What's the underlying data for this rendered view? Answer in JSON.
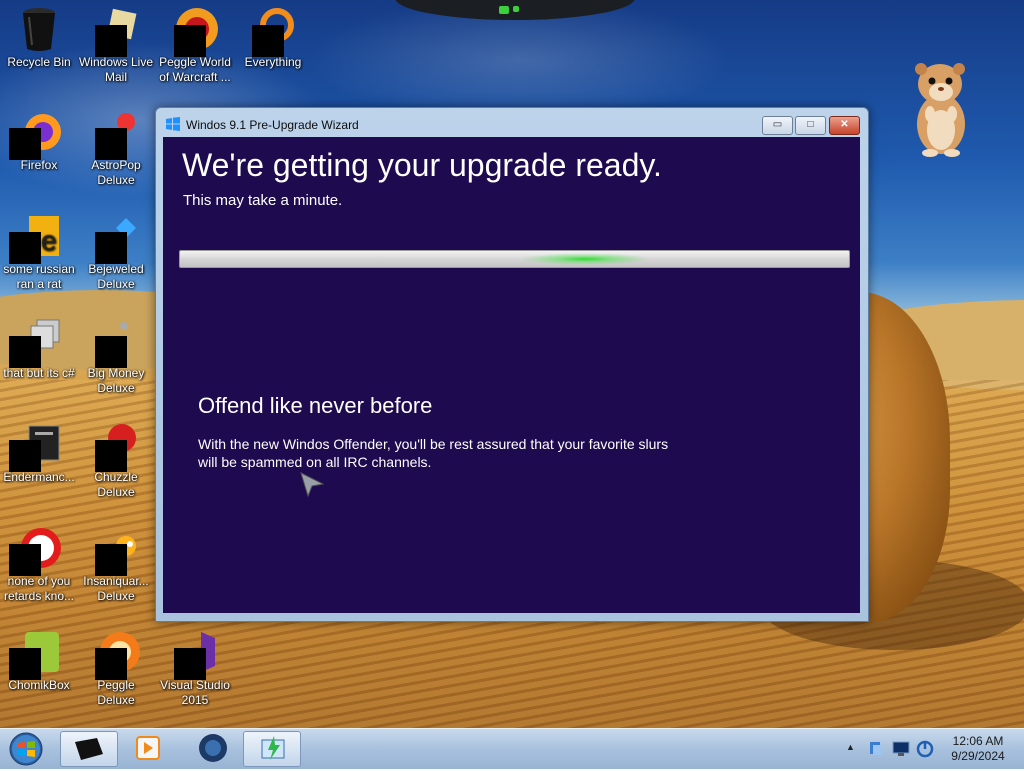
{
  "desktop": {
    "icons": [
      {
        "label": "Recycle Bin",
        "icon": "recycle-bin-icon"
      },
      {
        "label": "Windows Live Mail",
        "icon": "windows-live-mail-icon"
      },
      {
        "label": "Peggle World of Warcraft ...",
        "icon": "peggle-wow-icon"
      },
      {
        "label": "Everything",
        "icon": "everything-search-icon"
      },
      {
        "label": "Firefox",
        "icon": "firefox-icon"
      },
      {
        "label": "AstroPop Deluxe",
        "icon": "astropop-icon"
      },
      {
        "label": "some russian ran a rat",
        "icon": "rat-app-icon"
      },
      {
        "label": "Bejeweled Deluxe",
        "icon": "bejeweled-icon"
      },
      {
        "label": "that but its c#",
        "icon": "copy-app-icon"
      },
      {
        "label": "Big Money Deluxe",
        "icon": "big-money-icon"
      },
      {
        "label": "Endermanc...",
        "icon": "endermanch-icon"
      },
      {
        "label": "Chuzzle Deluxe",
        "icon": "chuzzle-icon"
      },
      {
        "label": "none of you retards kno...",
        "icon": "red-app-icon"
      },
      {
        "label": "Insaniquar... Deluxe",
        "icon": "insaniquarium-icon"
      },
      {
        "label": "ChomikBox",
        "icon": "chomikbox-icon"
      },
      {
        "label": "Peggle Deluxe",
        "icon": "peggle-icon"
      },
      {
        "label": "Visual Studio 2015",
        "icon": "visual-studio-icon"
      }
    ]
  },
  "window": {
    "title": "Windos 9.1 Pre-Upgrade Wizard",
    "buttons": {
      "minimize": "▭",
      "maximize": "□",
      "close": "✕"
    },
    "heading": "We're getting your upgrade ready.",
    "subheading": "This may take a minute.",
    "progress_indeterminate": true,
    "feature_title": "Offend like never before",
    "feature_body": "With the new Windos Offender, you'll be rest assured that your favorite slurs will be spammed on all IRC channels."
  },
  "taskbar": {
    "start_icon": "windows-orb-icon",
    "pinned": [
      "black-box-app-icon",
      "media-player-icon",
      "globe-browser-icon",
      "upgrade-wizard-icon"
    ],
    "tray_icons": [
      "show-hidden-icons-chevron",
      "network-icon",
      "display-icon",
      "volume-icon"
    ],
    "tray_chevron": "▲",
    "clock_time": "12:06 AM",
    "clock_date": "9/29/2024"
  },
  "colors": {
    "wizard_background": "#1e0a4e",
    "progress_glow": "#28dc28",
    "taskbar": "#a8c1de"
  }
}
